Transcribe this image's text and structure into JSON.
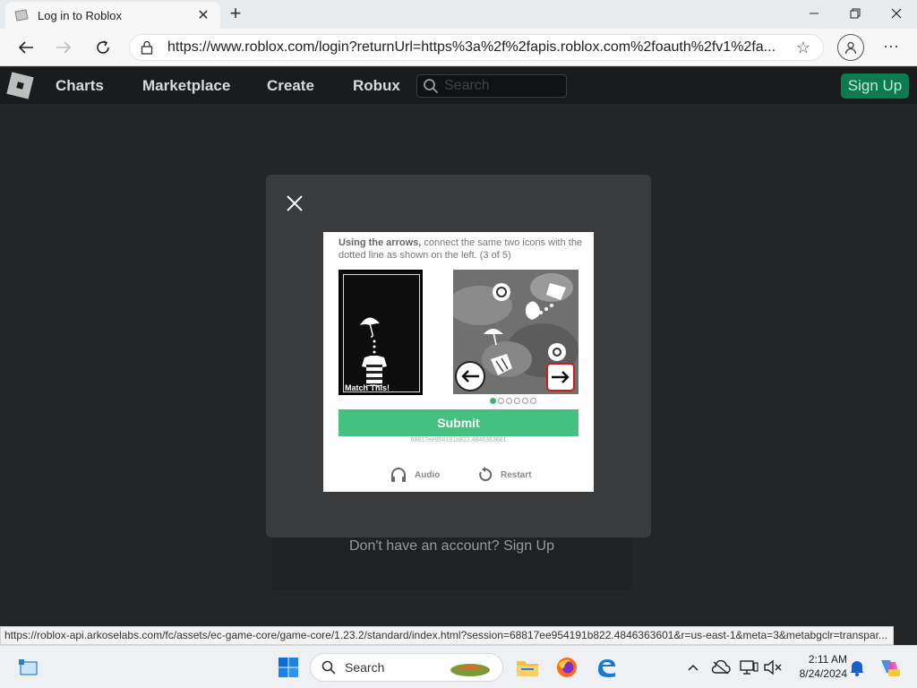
{
  "browser": {
    "tab_title": "Log in to Roblox",
    "url": "https://www.roblox.com/login?returnUrl=https%3a%2f%2fapis.roblox.com%2foauth%2fv1%2fa..."
  },
  "roblox": {
    "nav": [
      "Charts",
      "Marketplace",
      "Create",
      "Robux"
    ],
    "search_placeholder": "Search",
    "signup_label": "Sign Up",
    "no_account_text": "Don't have an account? Sign Up"
  },
  "captcha": {
    "instruction_bold": "Using the arrows,",
    "instruction_rest": " connect the same two icons with the dotted line as shown on the left. (3 of 5)",
    "match_label": "Match This!",
    "submit_label": "Submit",
    "session_id": "68817ee954191b822.4846363601",
    "audio_label": "Audio",
    "restart_label": "Restart",
    "current_page": 1,
    "total_pages": 6
  },
  "statusbar": {
    "url": "https://roblox-api.arkoselabs.com/fc/assets/ec-game-core/game-core/1.23.2/standard/index.html?session=68817ee954191b822.4846363601&r=us-east-1&meta=3&metabgclr=transpar..."
  },
  "taskbar": {
    "search_label": "Search",
    "time": "2:11 AM",
    "date": "8/24/2024"
  },
  "colors": {
    "page_bg": "#232527",
    "modal_bg": "#393b3d",
    "submit_green": "#44c080",
    "signup_green": "#0e7a4f"
  }
}
